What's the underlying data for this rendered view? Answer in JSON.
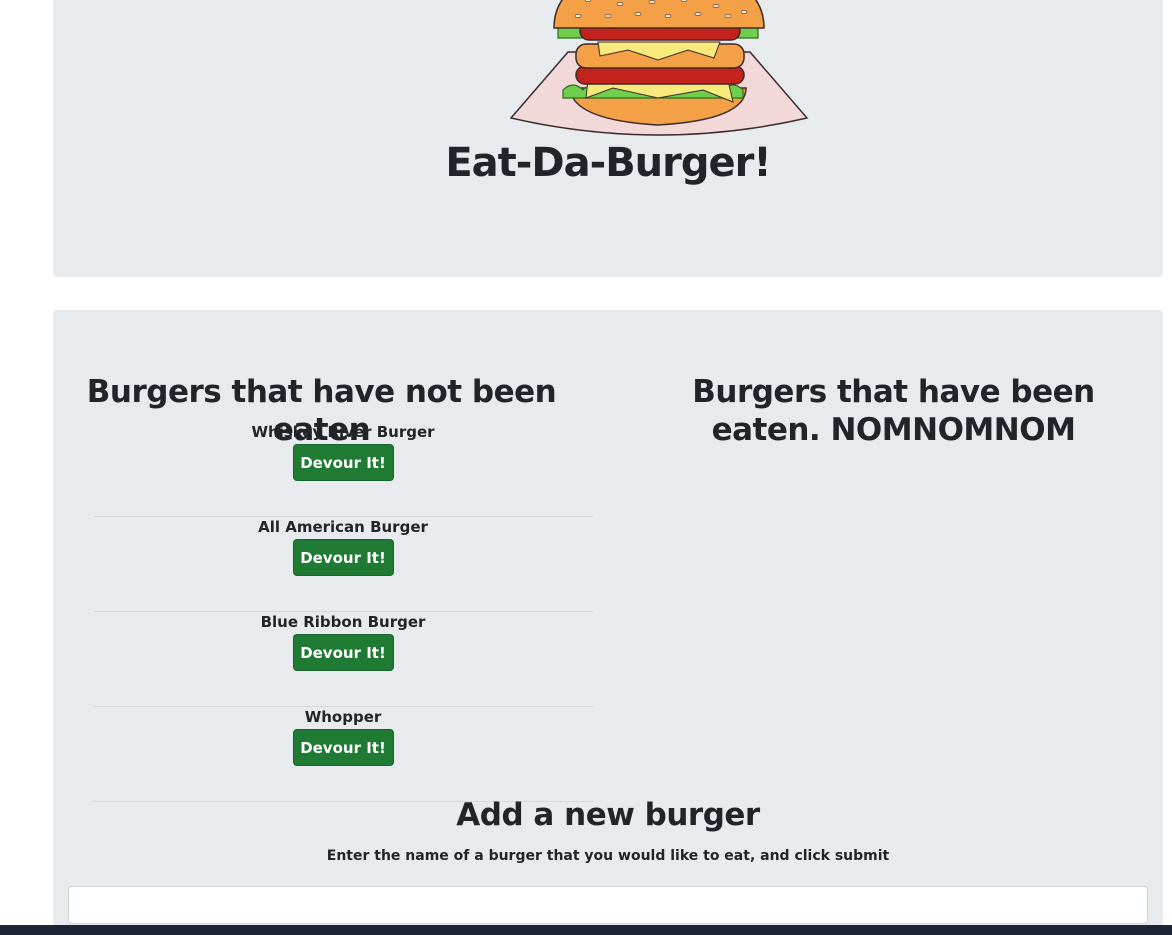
{
  "header": {
    "title": "Eat-Da-Burger!",
    "logo_icon": "burger-icon"
  },
  "uneaten": {
    "heading": "Burgers that have not been eaten",
    "items": [
      {
        "name": "Whiskey River Burger",
        "button": "Devour It!"
      },
      {
        "name": "All American Burger",
        "button": "Devour It!"
      },
      {
        "name": "Blue Ribbon Burger",
        "button": "Devour It!"
      },
      {
        "name": "Whopper",
        "button": "Devour It!"
      }
    ]
  },
  "eaten": {
    "heading": "Burgers that have been eaten. NOMNOMNOM",
    "items": []
  },
  "add_form": {
    "heading": "Add a new burger",
    "instructions": "Enter the name of a burger that you would like to eat, and click submit",
    "input_value": ""
  },
  "colors": {
    "jumbotron_bg": "#e8ebee",
    "button_bg": "#1f7a33",
    "button_text": "#ffffff",
    "heading_text": "#212529",
    "taskbar_bg": "#1c2536"
  }
}
